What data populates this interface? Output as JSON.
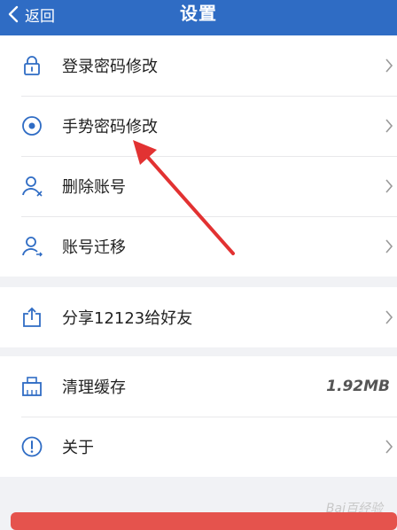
{
  "header": {
    "back_label": "返回",
    "title": "设置",
    "background": "#2f6cc4"
  },
  "groups": [
    [
      {
        "label": "登录密码修改",
        "icon": "lock-icon",
        "chevron": true
      },
      {
        "label": "手势密码修改",
        "icon": "gesture-icon",
        "chevron": true
      },
      {
        "label": "删除账号",
        "icon": "user-delete-icon",
        "chevron": true
      },
      {
        "label": "账号迁移",
        "icon": "user-migrate-icon",
        "chevron": true
      }
    ],
    [
      {
        "label": "分享12123给好友",
        "icon": "share-icon",
        "chevron": true
      }
    ],
    [
      {
        "label": "清理缓存",
        "icon": "broom-icon",
        "value": "1.92MB"
      },
      {
        "label": "关于",
        "icon": "info-icon",
        "chevron": true
      }
    ]
  ],
  "annotation_arrow_color": "#e23232",
  "watermark": "Bai百经验",
  "bottom_button_color": "#e5534d"
}
